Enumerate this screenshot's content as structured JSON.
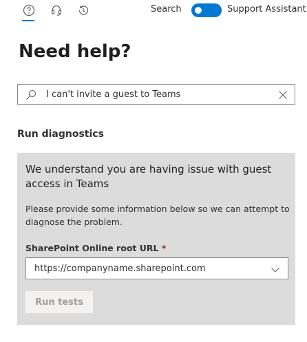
{
  "toolbar": {
    "tabs": [
      {
        "icon": "help-icon",
        "active": true
      },
      {
        "icon": "headset-icon",
        "active": false
      },
      {
        "icon": "history-icon",
        "active": false
      }
    ],
    "search_label": "Search",
    "toggle_on": true,
    "assistant_label": "Support Assistant"
  },
  "page": {
    "title": "Need help?"
  },
  "search": {
    "value": "I can't invite a guest to Teams"
  },
  "diagnostics": {
    "section_title": "Run diagnostics",
    "heading": "We understand you are having issue with guest access in Teams",
    "description": "Please provide some information below so we can attempt to diagnose the problem.",
    "field_label": "SharePoint Online root URL",
    "required_mark": "*",
    "url_value": "https://companyname.sharepoint.com",
    "run_button_label": "Run tests"
  },
  "colors": {
    "accent": "#0078d4",
    "panel_bg": "#dcdcdc",
    "required": "#a4262c",
    "disabled_text": "#a19f9d"
  }
}
